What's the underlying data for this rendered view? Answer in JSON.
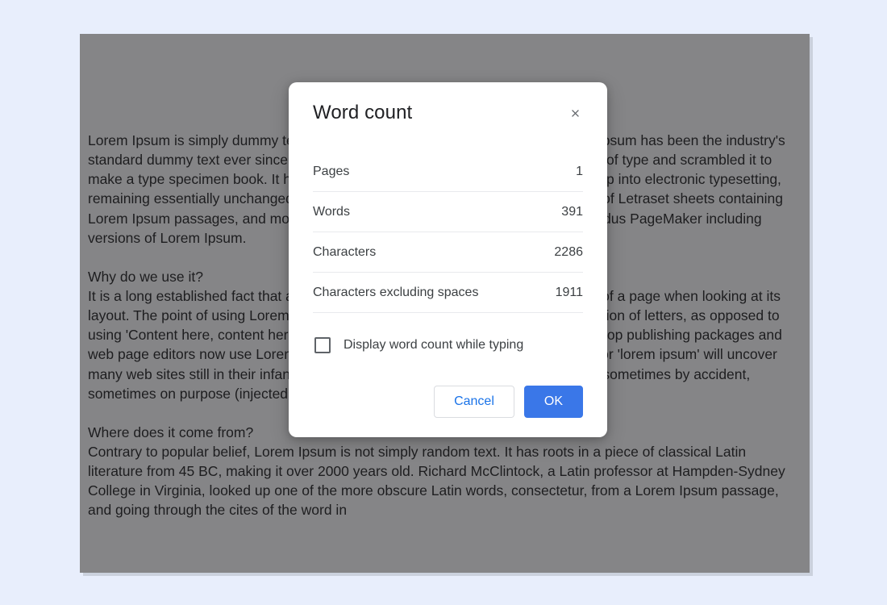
{
  "document": {
    "paragraphs": [
      "Lorem Ipsum is simply dummy text of the printing and typesetting industry. Lorem Ipsum has been the industry's standard dummy text ever since the 1500s, when an unknown printer took a galley of type and scrambled it to make a type specimen book. It has survived not only five centuries, but also the leap into electronic typesetting, remaining essentially unchanged. It was popularised in the 1960s with the release of Letraset sheets containing Lorem Ipsum passages, and more recently with desktop publishing software like Aldus PageMaker including versions of Lorem Ipsum.",
      "Why do we use it?\nIt is a long established fact that a reader will be distracted by the readable content of a page when looking at its layout. The point of using Lorem Ipsum is that it has a more-or-less normal distribution of letters, as opposed to using 'Content here, content here', making it look like readable English. Many desktop publishing packages and web page editors now use Lorem Ipsum as their default model text, and a search for 'lorem ipsum' will uncover many web sites still in their infancy. Various versions have evolved over the years, sometimes by accident, sometimes on purpose (injected humour and the like).",
      "Where does it come from?\nContrary to popular belief, Lorem Ipsum is not simply random text. It has roots in a piece of classical Latin literature from 45 BC, making it over 2000 years old. Richard McClintock, a Latin professor at Hampden-Sydney College in Virginia, looked up one of the more obscure Latin words, consectetur, from a Lorem Ipsum passage, and going through the cites of the word in"
    ]
  },
  "dialog": {
    "title": "Word count",
    "rows": {
      "pages": {
        "label": "Pages",
        "value": "1"
      },
      "words": {
        "label": "Words",
        "value": "391"
      },
      "chars": {
        "label": "Characters",
        "value": "2286"
      },
      "chars_nosp": {
        "label": "Characters excluding spaces",
        "value": "1911"
      }
    },
    "checkbox_label": "Display word count while typing",
    "checkbox_checked": false,
    "buttons": {
      "cancel": "Cancel",
      "ok": "OK"
    }
  }
}
